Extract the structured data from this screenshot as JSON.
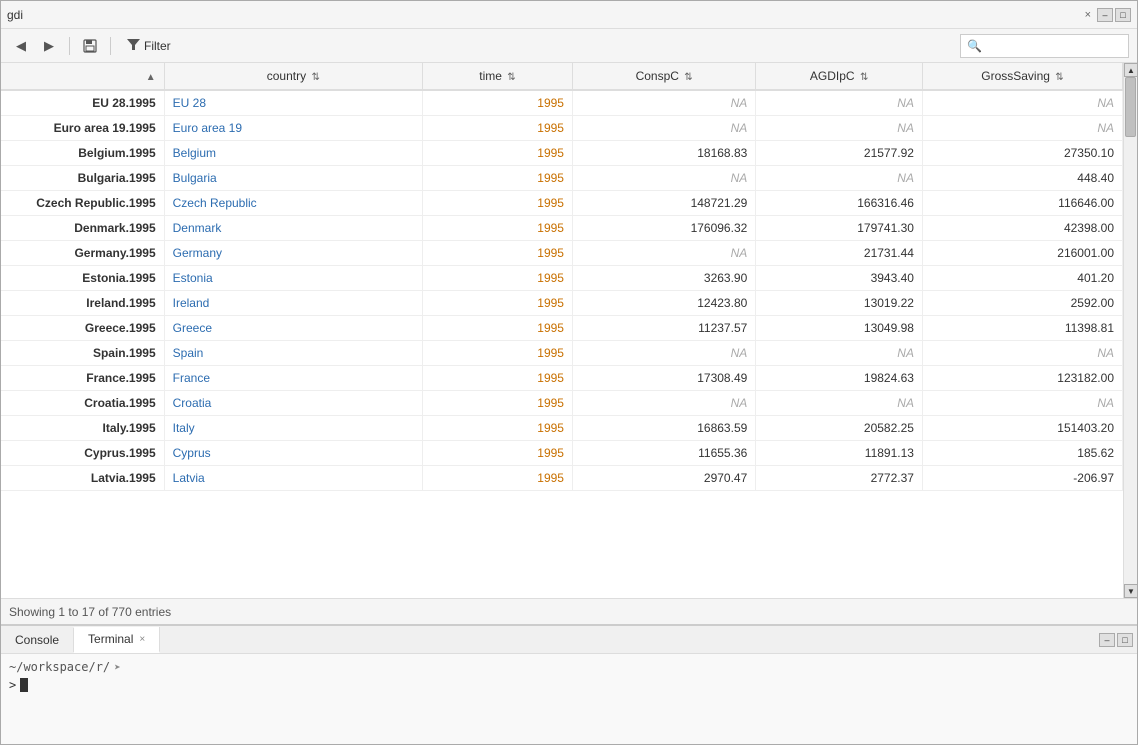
{
  "titleBar": {
    "title": "gdi",
    "closeLabel": "×"
  },
  "toolbar": {
    "filterLabel": "Filter",
    "searchPlaceholder": "",
    "backLabel": "◀",
    "forwardLabel": "▶",
    "saveLabel": "💾"
  },
  "table": {
    "columns": [
      {
        "key": "rowname",
        "label": "",
        "sortable": false
      },
      {
        "key": "country",
        "label": "country",
        "sortable": true
      },
      {
        "key": "time",
        "label": "time",
        "sortable": true
      },
      {
        "key": "conspc",
        "label": "ConspC",
        "sortable": true
      },
      {
        "key": "agdipc",
        "label": "AGDIpC",
        "sortable": true
      },
      {
        "key": "grosssaving",
        "label": "GrossSaving",
        "sortable": true
      }
    ],
    "rows": [
      {
        "rowname": "EU 28.1995",
        "country": "EU 28",
        "time": "1995",
        "conspc": "NA",
        "agdipc": "NA",
        "grosssaving": "NA"
      },
      {
        "rowname": "Euro area 19.1995",
        "country": "Euro area 19",
        "time": "1995",
        "conspc": "NA",
        "agdipc": "NA",
        "grosssaving": "NA"
      },
      {
        "rowname": "Belgium.1995",
        "country": "Belgium",
        "time": "1995",
        "conspc": "18168.83",
        "agdipc": "21577.92",
        "grosssaving": "27350.10"
      },
      {
        "rowname": "Bulgaria.1995",
        "country": "Bulgaria",
        "time": "1995",
        "conspc": "NA",
        "agdipc": "NA",
        "grosssaving": "448.40"
      },
      {
        "rowname": "Czech Republic.1995",
        "country": "Czech Republic",
        "time": "1995",
        "conspc": "148721.29",
        "agdipc": "166316.46",
        "grosssaving": "116646.00"
      },
      {
        "rowname": "Denmark.1995",
        "country": "Denmark",
        "time": "1995",
        "conspc": "176096.32",
        "agdipc": "179741.30",
        "grosssaving": "42398.00"
      },
      {
        "rowname": "Germany.1995",
        "country": "Germany",
        "time": "1995",
        "conspc": "NA",
        "agdipc": "21731.44",
        "grosssaving": "216001.00"
      },
      {
        "rowname": "Estonia.1995",
        "country": "Estonia",
        "time": "1995",
        "conspc": "3263.90",
        "agdipc": "3943.40",
        "grosssaving": "401.20"
      },
      {
        "rowname": "Ireland.1995",
        "country": "Ireland",
        "time": "1995",
        "conspc": "12423.80",
        "agdipc": "13019.22",
        "grosssaving": "2592.00"
      },
      {
        "rowname": "Greece.1995",
        "country": "Greece",
        "time": "1995",
        "conspc": "11237.57",
        "agdipc": "13049.98",
        "grosssaving": "11398.81"
      },
      {
        "rowname": "Spain.1995",
        "country": "Spain",
        "time": "1995",
        "conspc": "NA",
        "agdipc": "NA",
        "grosssaving": "NA"
      },
      {
        "rowname": "France.1995",
        "country": "France",
        "time": "1995",
        "conspc": "17308.49",
        "agdipc": "19824.63",
        "grosssaving": "123182.00"
      },
      {
        "rowname": "Croatia.1995",
        "country": "Croatia",
        "time": "1995",
        "conspc": "NA",
        "agdipc": "NA",
        "grosssaving": "NA"
      },
      {
        "rowname": "Italy.1995",
        "country": "Italy",
        "time": "1995",
        "conspc": "16863.59",
        "agdipc": "20582.25",
        "grosssaving": "151403.20"
      },
      {
        "rowname": "Cyprus.1995",
        "country": "Cyprus",
        "time": "1995",
        "conspc": "11655.36",
        "agdipc": "11891.13",
        "grosssaving": "185.62"
      },
      {
        "rowname": "Latvia.1995",
        "country": "Latvia",
        "time": "1995",
        "conspc": "2970.47",
        "agdipc": "2772.37",
        "grosssaving": "-206.97"
      }
    ]
  },
  "statusBar": {
    "text": "Showing 1 to 17 of 770 entries"
  },
  "bottomPanel": {
    "tabs": [
      {
        "label": "Console",
        "closeable": false,
        "active": false
      },
      {
        "label": "Terminal",
        "closeable": true,
        "active": true
      }
    ],
    "consolePath": "~/workspace/r/",
    "prompt": ">"
  },
  "naValues": [
    "NA"
  ],
  "colors": {
    "countryLink": "#2c6cb0",
    "timeValue": "#c87000",
    "naColor": "#aaa"
  }
}
